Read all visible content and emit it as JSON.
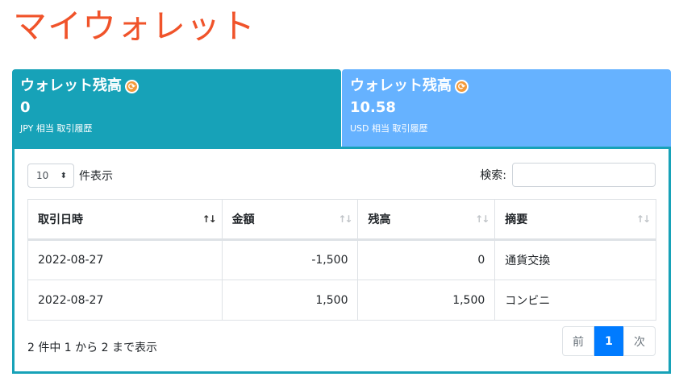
{
  "page_title": "マイウォレット",
  "cards": [
    {
      "title": "ウォレット残高",
      "value": "0",
      "sub_currency": "JPY 相当",
      "sub_link": "取引履歴",
      "color": "#17a2b8"
    },
    {
      "title": "ウォレット残高",
      "value": "10.58",
      "sub_currency": "USD 相当",
      "sub_link": "取引履歴",
      "color": "#66b2ff"
    }
  ],
  "table_controls": {
    "length_value": "10",
    "length_suffix": "件表示",
    "search_label": "検索:",
    "search_value": ""
  },
  "table": {
    "headers": [
      "取引日時",
      "金額",
      "残高",
      "摘要"
    ],
    "rows": [
      [
        "2022-08-27",
        "-1,500",
        "0",
        "通貨交換"
      ],
      [
        "2022-08-27",
        "1,500",
        "1,500",
        "コンビニ"
      ]
    ]
  },
  "info_text": "2 件中 1 から 2 まで表示",
  "pagination": {
    "prev": "前",
    "current": "1",
    "next": "次"
  },
  "colors": {
    "title": "#f0532a",
    "accent": "#007bff",
    "panel_border": "#17a2b8"
  }
}
